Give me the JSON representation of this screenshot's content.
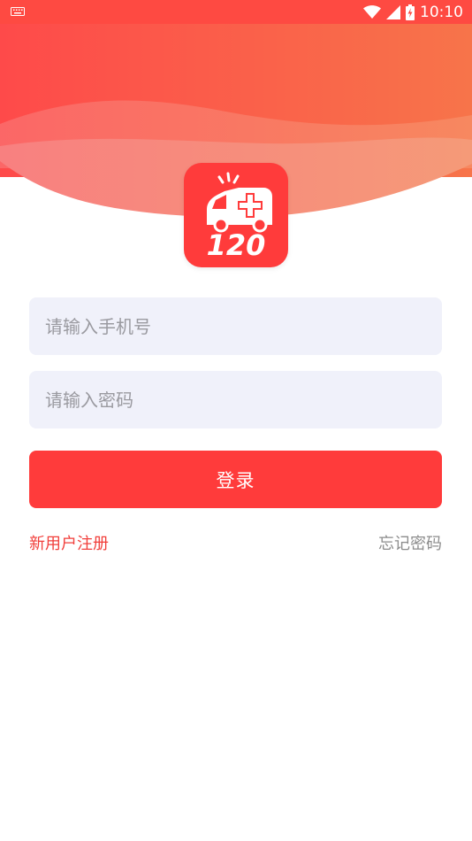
{
  "status_bar": {
    "time": "10:10",
    "icons": [
      "keyboard-icon",
      "wifi-icon",
      "signal-icon",
      "battery-icon"
    ]
  },
  "logo": {
    "text": "120",
    "icon": "ambulance-icon"
  },
  "form": {
    "phone_placeholder": "请输入手机号",
    "password_placeholder": "请输入密码",
    "login_label": "登录"
  },
  "links": {
    "register": "新用户注册",
    "forgot_password": "忘记密码"
  },
  "colors": {
    "primary": "#ff3b3b",
    "status_bar": "#fe4a42",
    "input_bg": "#f0f1fa",
    "register_link": "#f13e3a",
    "muted_link": "#8c8c8c"
  }
}
